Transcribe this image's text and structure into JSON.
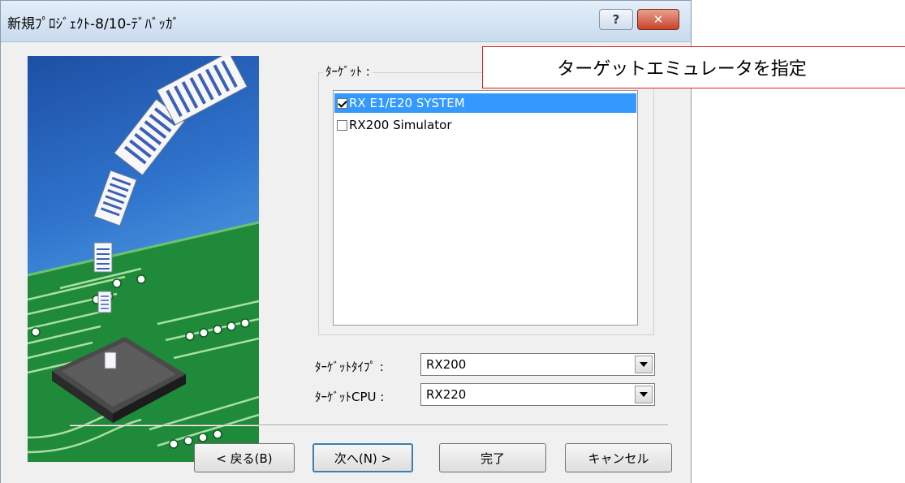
{
  "window": {
    "title": "新規ﾌﾟﾛｼﾞｪｸﾄ-8/10-ﾃﾞﾊﾞｯｶﾞ",
    "help_glyph": "?",
    "close_glyph": "✕"
  },
  "target_group": {
    "label": "ﾀｰｹﾞｯﾄ :",
    "items": [
      {
        "label": "RX E1/E20 SYSTEM",
        "checked": true,
        "selected": true
      },
      {
        "label": "RX200 Simulator",
        "checked": false,
        "selected": false
      }
    ]
  },
  "fields": {
    "target_type": {
      "label": "ﾀｰｹﾞｯﾄﾀｲﾌﾟ :",
      "value": "RX200"
    },
    "target_cpu": {
      "label": "ﾀｰｹﾞｯﾄCPU :",
      "value": "RX220"
    }
  },
  "buttons": {
    "back": "< 戻る(B)",
    "next": "次へ(N) >",
    "finish": "完了",
    "cancel": "キャンセル"
  },
  "callout": {
    "text": "ターゲットエミュレータを指定"
  },
  "colors": {
    "selection": "#3399ff",
    "callout_border": "#e02020",
    "pcb_green": "#1f8a3a"
  }
}
